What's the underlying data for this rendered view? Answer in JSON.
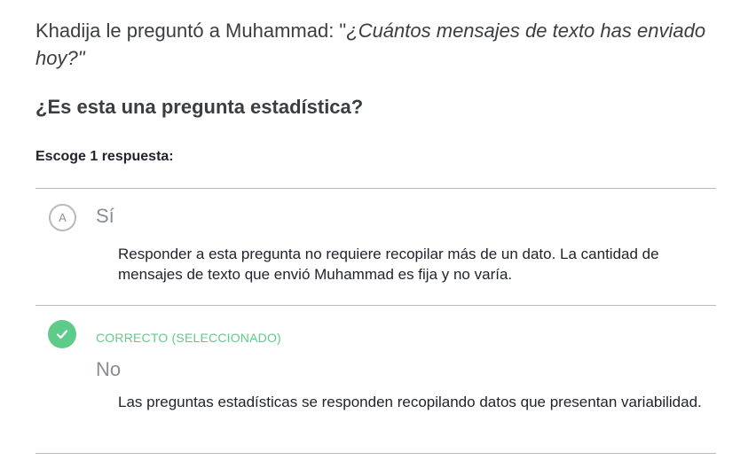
{
  "question": {
    "prefix": "Khadija le preguntó a Muhammad: \"",
    "quote": "¿Cuántos mensajes de texto has enviado hoy?",
    "suffix": "\""
  },
  "prompt": "¿Es esta una pregunta estadística?",
  "instruction": "Escoge 1 respuesta:",
  "choices": [
    {
      "letter": "A",
      "label": "Sí",
      "rationale": "Responder a esta pregunta no requiere recopilar más de un dato. La cantidad de mensajes de texto que envió Muhammad es fija y no varía."
    },
    {
      "status": "CORRECTO (SELECCIONADO)",
      "label": "No",
      "rationale": "Las preguntas estadísticas se responden recopilando datos que presentan variabilidad.",
      "icon": "checkmark-icon",
      "color": "#5fcb8a"
    }
  ]
}
